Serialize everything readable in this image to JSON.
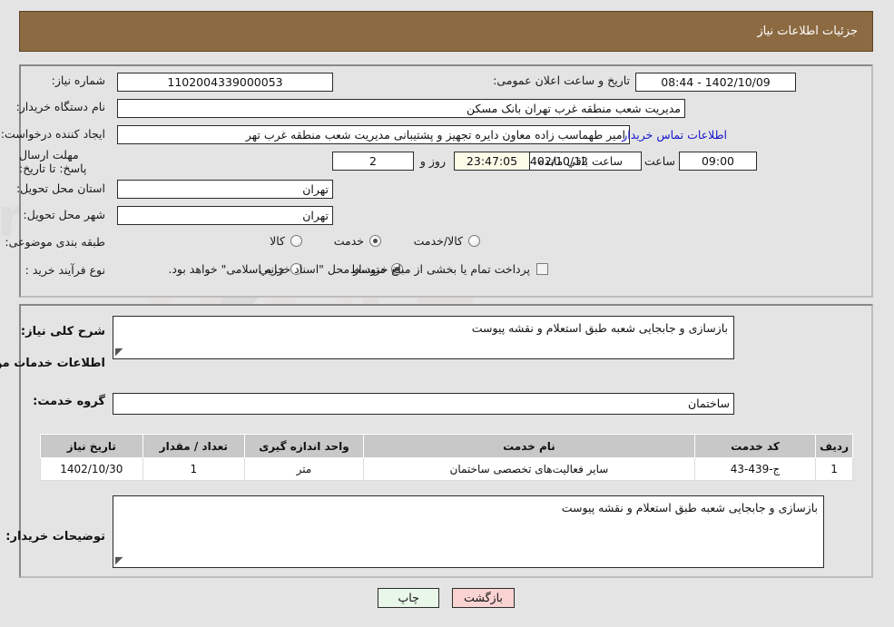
{
  "header": {
    "title": "جزئیات اطلاعات نیاز"
  },
  "watermark": {
    "text": "AriaTender.net"
  },
  "summary": {
    "need_number_label": "شماره نیاز:",
    "need_number_value": "1102004339000053",
    "public_announce_label": "تاریخ و ساعت اعلان عمومی:",
    "public_announce_value": "08:44 - 1402/10/09",
    "buyer_org_label": "نام دستگاه خریدار:",
    "buyer_org_value": "مدیریت شعب منطقه غرب تهران بانک مسکن",
    "creator_label": "ایجاد کننده درخواست:",
    "creator_value": "امیر طهماسب زاده معاون دایره تجهیز و پشتیبانی مدیریت شعب منطقه غرب تهر",
    "contact_link": "اطلاعات تماس خریدار",
    "deadline_label": "مهلت ارسال پاسخ: تا تاریخ:",
    "deadline_date": "1402/10/12",
    "hour_label": "ساعت",
    "deadline_time": "09:00",
    "days_value": "2",
    "days_label": "روز و",
    "countdown_value": "23:47:05",
    "remaining_label": "ساعت باقي مانده",
    "province_label": "استان محل تحویل:",
    "province_value": "تهران",
    "city_label": "شهر محل تحویل:",
    "city_value": "تهران",
    "category_label": "طبقه بندی موضوعی:",
    "category_options": [
      {
        "label": "کالا",
        "selected": false
      },
      {
        "label": "خدمت",
        "selected": true
      },
      {
        "label": "کالا/خدمت",
        "selected": false
      }
    ],
    "process_label": "نوع فرآیند خرید :",
    "process_options": [
      {
        "label": "جزیي",
        "selected": false
      },
      {
        "label": "متوسط",
        "selected": true
      }
    ],
    "payment_note": "پرداخت تمام یا بخشی از مبلغ خرید،از محل \"اسناد خزانه اسلامی\" خواهد بود.",
    "payment_checked": false
  },
  "details": {
    "general_desc_label": "شرح کلی نیاز:",
    "general_desc_value": "بازسازی و جابجایی شعبه طبق استعلام و نقشه پیوست",
    "services_section_title": "اطلاعات خدمات مورد نیاز",
    "service_group_label": "گروه خدمت:",
    "service_group_value": "ساختمان",
    "buyer_notes_label": "توضیحات خریدار:",
    "buyer_notes_value": "بازسازی و جابجایی شعبه طبق استعلام و نقشه پیوست"
  },
  "table": {
    "columns": [
      "ردیف",
      "کد خدمت",
      "نام خدمت",
      "واحد اندازه گیری",
      "تعداد / مقدار",
      "تاریخ نیاز"
    ],
    "rows": [
      {
        "row": "1",
        "code": "ج-439-43",
        "name": "سایر فعالیت‌های تخصصی ساختمان",
        "unit": "متر",
        "qty": "1",
        "date": "1402/10/30"
      }
    ]
  },
  "buttons": {
    "print": "چاپ",
    "back": "بازگشت"
  },
  "colors": {
    "header_bg": "#8c6a42",
    "page_bg": "#e4e4e4",
    "link": "#1414cc",
    "countdown_bg": "#fbfbe8",
    "print_btn_bg": "#e8f7e8",
    "back_btn_bg": "#f9d2d2",
    "table_header_bg": "#c8c8c8"
  }
}
